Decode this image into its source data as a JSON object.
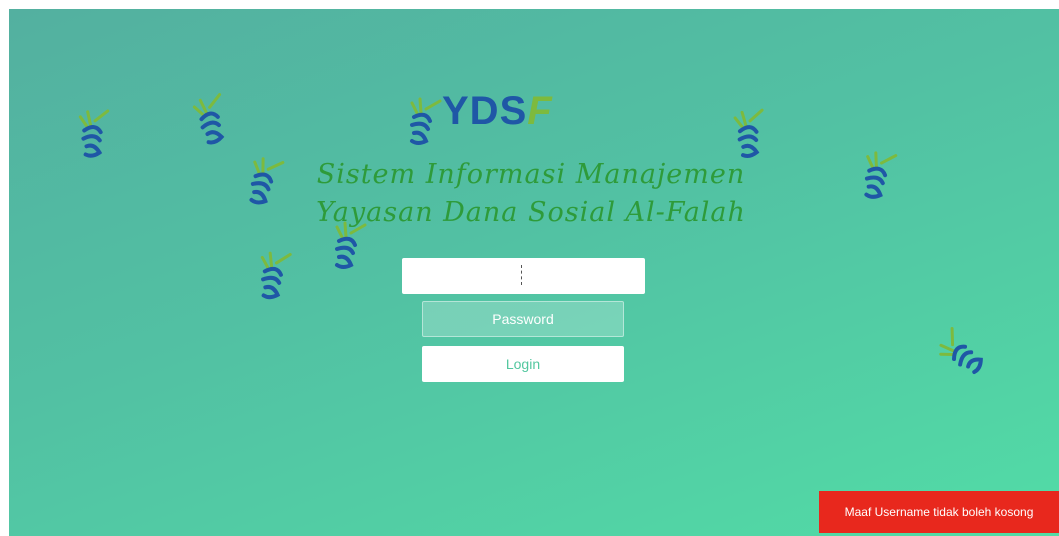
{
  "brand": {
    "logo_text": "YDS",
    "logo_accent": "F"
  },
  "title": {
    "line1": "Sistem Informasi Manajemen",
    "line2": "Yayasan Dana Sosial Al-Falah"
  },
  "form": {
    "username_value": "",
    "password_placeholder": "Password",
    "login_label": "Login"
  },
  "toast": {
    "message": "Maaf Username tidak boleh kosong"
  },
  "colors": {
    "background_start": "#53b0a0",
    "background_end": "#52dca6",
    "title_green": "#2e9b3a",
    "logo_blue": "#1f57a6",
    "logo_green": "#7dba3e",
    "toast_red": "#e8281d",
    "login_text": "#53c79f"
  },
  "decorations": {
    "floating_logo_icon": "ydsf-leaf-icon"
  }
}
